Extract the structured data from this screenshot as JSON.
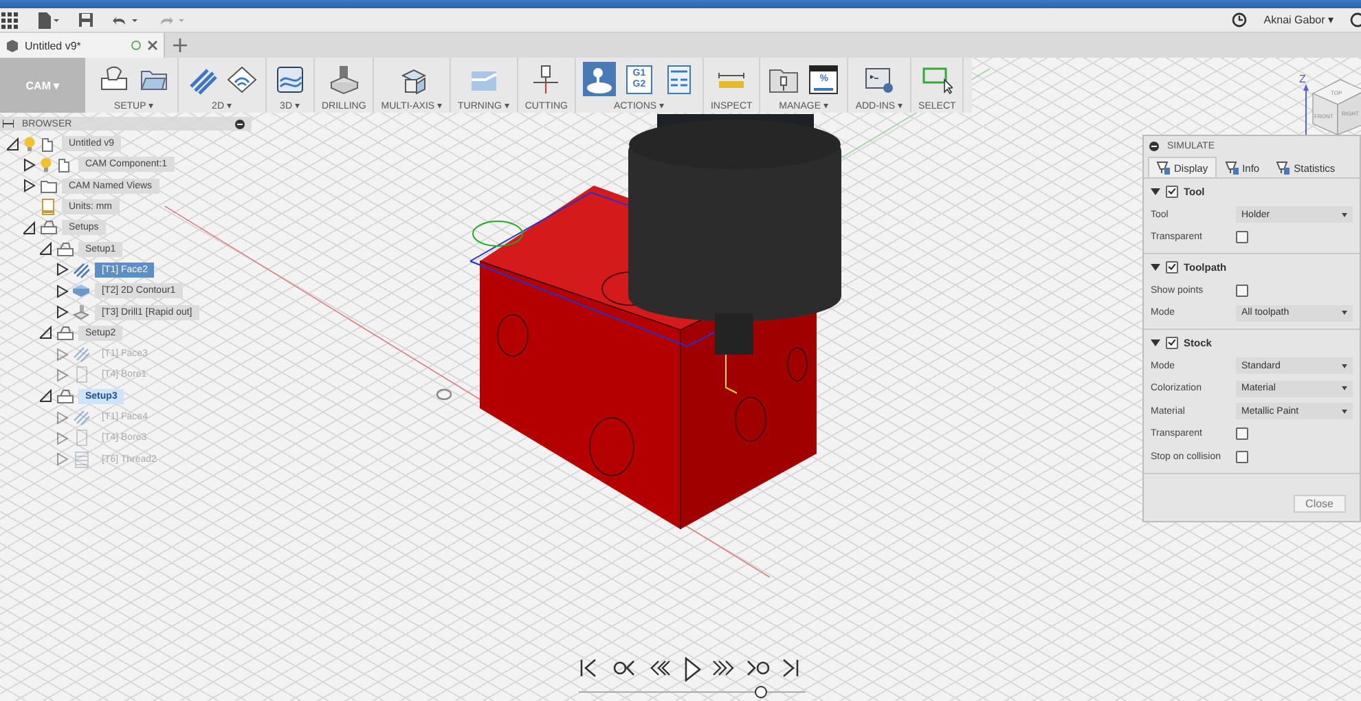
{
  "quick_access": {
    "user": "Aknai Gabor ▾"
  },
  "document_tab": {
    "title": "Untitled v9*"
  },
  "ribbon": {
    "workspace": "CAM ▾",
    "groups": [
      {
        "label": "SETUP ▾",
        "tools": [
          {
            "kind": "setup",
            "selected": false
          },
          {
            "kind": "folder",
            "selected": false
          }
        ]
      },
      {
        "label": "2D ▾",
        "tools": [
          {
            "kind": "stripes",
            "selected": false
          },
          {
            "kind": "contour",
            "selected": false
          }
        ]
      },
      {
        "label": "3D ▾",
        "tools": [
          {
            "kind": "surface",
            "selected": false
          }
        ]
      },
      {
        "label": "DRILLING",
        "tools": [
          {
            "kind": "drill",
            "selected": false
          }
        ]
      },
      {
        "label": "MULTI-AXIS ▾",
        "tools": [
          {
            "kind": "multiaxis",
            "selected": false
          }
        ]
      },
      {
        "label": "TURNING ▾",
        "tools": [
          {
            "kind": "turning",
            "selected": false
          }
        ]
      },
      {
        "label": "CUTTING",
        "tools": [
          {
            "kind": "cutting",
            "selected": false
          }
        ]
      },
      {
        "label": "ACTIONS ▾",
        "tools": [
          {
            "kind": "simulate",
            "selected": true
          },
          {
            "kind": "code",
            "selected": false,
            "text": [
              "G1",
              "G2"
            ]
          },
          {
            "kind": "sheet",
            "selected": false
          }
        ]
      },
      {
        "label": "INSPECT",
        "tools": [
          {
            "kind": "measure",
            "selected": false
          }
        ]
      },
      {
        "label": "MANAGE ▾",
        "tools": [
          {
            "kind": "library",
            "selected": false
          },
          {
            "kind": "window",
            "selected": false,
            "text": [
              "%"
            ]
          }
        ]
      },
      {
        "label": "ADD-INS ▾",
        "tools": [
          {
            "kind": "addins",
            "selected": false
          }
        ]
      },
      {
        "label": "SELECT",
        "tools": [
          {
            "kind": "select",
            "selected": false
          }
        ]
      }
    ]
  },
  "browser": {
    "title": "BROWSER",
    "nodes": [
      {
        "label": "Untitled v9",
        "kind": "document",
        "expanded": true,
        "selected": false,
        "active": false,
        "disabled": false,
        "children": [
          {
            "label": "CAM Component:1",
            "kind": "component",
            "expanded": false,
            "selected": false,
            "active": false,
            "disabled": false
          },
          {
            "label": "CAM Named Views",
            "kind": "folder",
            "expanded": false,
            "selected": false,
            "active": false,
            "disabled": false
          },
          {
            "label": "Units: mm",
            "kind": "units",
            "selected": false,
            "active": false,
            "disabled": false
          },
          {
            "label": "Setups",
            "kind": "setup",
            "expanded": true,
            "selected": false,
            "active": false,
            "disabled": false,
            "children": [
              {
                "label": "Setup1",
                "kind": "setup",
                "expanded": true,
                "selected": false,
                "active": false,
                "disabled": false,
                "children": [
                  {
                    "label": "[T1] Face2",
                    "kind": "face",
                    "expanded": false,
                    "selected": true,
                    "active": false,
                    "disabled": false
                  },
                  {
                    "label": "[T2] 2D Contour1",
                    "kind": "contour",
                    "expanded": false,
                    "selected": false,
                    "active": false,
                    "disabled": false
                  },
                  {
                    "label": "[T3] Drill1 [Rapid out]",
                    "kind": "drill",
                    "expanded": false,
                    "selected": false,
                    "active": false,
                    "disabled": false
                  }
                ]
              },
              {
                "label": "Setup2",
                "kind": "setup",
                "expanded": true,
                "selected": false,
                "active": false,
                "disabled": false,
                "children": [
                  {
                    "label": "[T1] Face3",
                    "kind": "face",
                    "expanded": false,
                    "selected": false,
                    "active": false,
                    "disabled": true
                  },
                  {
                    "label": "[T4] Bore1",
                    "kind": "bore",
                    "expanded": false,
                    "selected": false,
                    "active": false,
                    "disabled": true
                  }
                ]
              },
              {
                "label": "Setup3",
                "kind": "setup",
                "expanded": true,
                "selected": false,
                "active": true,
                "disabled": false,
                "children": [
                  {
                    "label": "[T1] Face4",
                    "kind": "face",
                    "expanded": false,
                    "selected": false,
                    "active": false,
                    "disabled": true
                  },
                  {
                    "label": "[T4] Bore3",
                    "kind": "bore",
                    "expanded": false,
                    "selected": false,
                    "active": false,
                    "disabled": true
                  },
                  {
                    "label": "[T6] Thread2",
                    "kind": "thread",
                    "expanded": false,
                    "selected": false,
                    "active": false,
                    "disabled": true
                  }
                ]
              }
            ]
          }
        ]
      }
    ]
  },
  "viewcube": {
    "axis": "Z",
    "faces": [
      "TOP",
      "FRONT",
      "RIGHT"
    ]
  },
  "simulate": {
    "title": "SIMULATE",
    "tabs": [
      {
        "label": "Display",
        "selected": true
      },
      {
        "label": "Info",
        "selected": false
      },
      {
        "label": "Statistics",
        "selected": false
      }
    ],
    "sections": [
      {
        "title": "Tool",
        "checked": true,
        "expanded": true,
        "rows": [
          {
            "kind": "select",
            "label": "Tool",
            "value": "Holder"
          },
          {
            "kind": "checkbox",
            "label": "Transparent",
            "checked": false
          }
        ]
      },
      {
        "title": "Toolpath",
        "checked": true,
        "expanded": true,
        "rows": [
          {
            "kind": "checkbox",
            "label": "Show points",
            "checked": false
          },
          {
            "kind": "select",
            "label": "Mode",
            "value": "All toolpath"
          }
        ]
      },
      {
        "title": "Stock",
        "checked": true,
        "expanded": true,
        "rows": [
          {
            "kind": "select",
            "label": "Mode",
            "value": "Standard"
          },
          {
            "kind": "select",
            "label": "Colorization",
            "value": "Material"
          },
          {
            "kind": "select",
            "label": "Material",
            "value": "Metallic Paint"
          },
          {
            "kind": "checkbox",
            "label": "Transparent",
            "checked": false
          },
          {
            "kind": "checkbox",
            "label": "Stop on collision",
            "checked": false
          }
        ]
      }
    ],
    "close_button": "Close"
  },
  "playback": {
    "level": 0.8
  }
}
